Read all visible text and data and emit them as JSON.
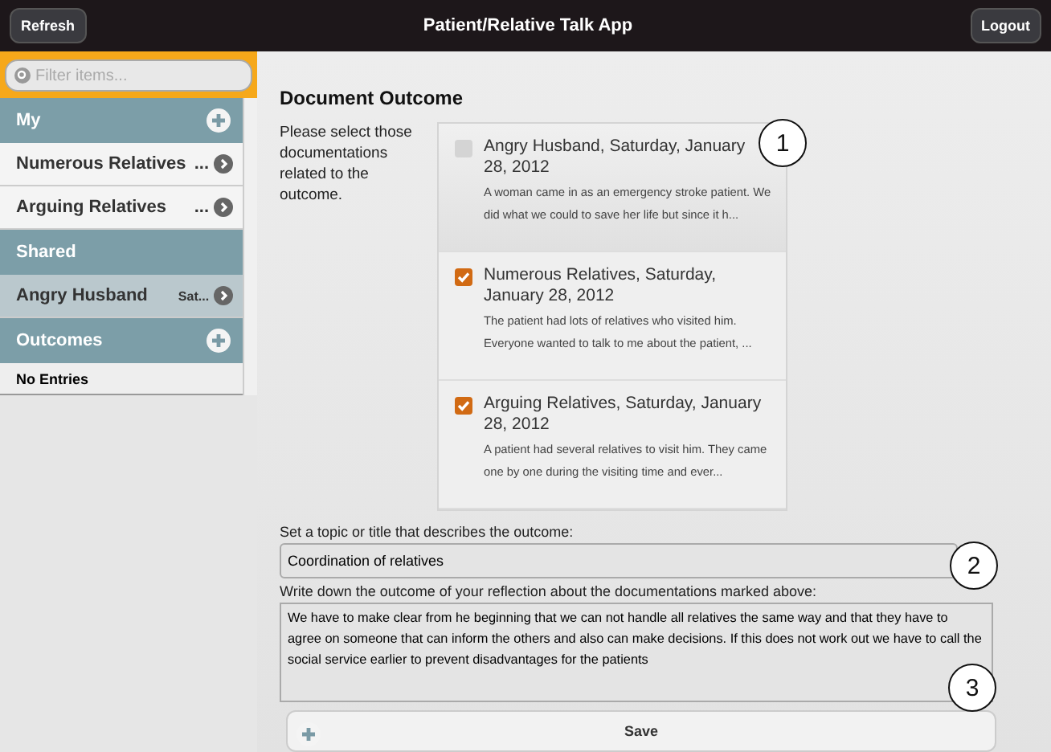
{
  "header": {
    "left_button": "Refresh",
    "title": "Patient/Relative Talk App",
    "right_button": "Logout"
  },
  "sidebar": {
    "filter": {
      "placeholder": "Filter items..."
    },
    "items": [
      {
        "kind": "header",
        "label": "My",
        "add": true
      },
      {
        "kind": "item",
        "label": "Numerous Relatives",
        "detail": "...",
        "selected": false
      },
      {
        "kind": "item",
        "label": "Arguing Relatives",
        "detail": "...",
        "selected": false
      },
      {
        "kind": "header",
        "label": "Shared",
        "add": false
      },
      {
        "kind": "item",
        "label": "Angry Husband",
        "detail": "Sat...",
        "selected": true
      },
      {
        "kind": "header",
        "label": "Outcomes",
        "add": true
      },
      {
        "kind": "empty",
        "label": "No Entries"
      }
    ]
  },
  "main": {
    "title": "Document Outcome",
    "instruction": "Please select those documentations related to the outcome.",
    "documents": [
      {
        "title": "Angry Husband, Saturday, January 28, 2012",
        "excerpt": "A woman came in as an emergency stroke patient. We did what we could to save her life but since it h...",
        "checked": false
      },
      {
        "title": "Numerous Relatives, Saturday, January 28, 2012",
        "excerpt": "The patient had lots of relatives who visited him. Everyone wanted to talk to me about the patient, ...",
        "checked": true
      },
      {
        "title": "Arguing Relatives, Saturday, January 28, 2012",
        "excerpt": "A patient had several relatives to visit him. They came one by one during the visiting time and ever...",
        "checked": true
      }
    ],
    "topic_label": "Set a topic or title that describes the outcome:",
    "topic_value": "Coordination of relatives",
    "outcome_label": "Write down the outcome of your reflection about the documentations marked above:",
    "outcome_value": "We have to make clear from he beginning that we can not handle all relatives the same way and that they have to agree on someone that can inform the others and also can make decisions. If this does not work out we have to call the social service earlier to prevent disadvantages for the patients",
    "save_button": "Save"
  },
  "callouts": [
    "1",
    "2",
    "3"
  ]
}
